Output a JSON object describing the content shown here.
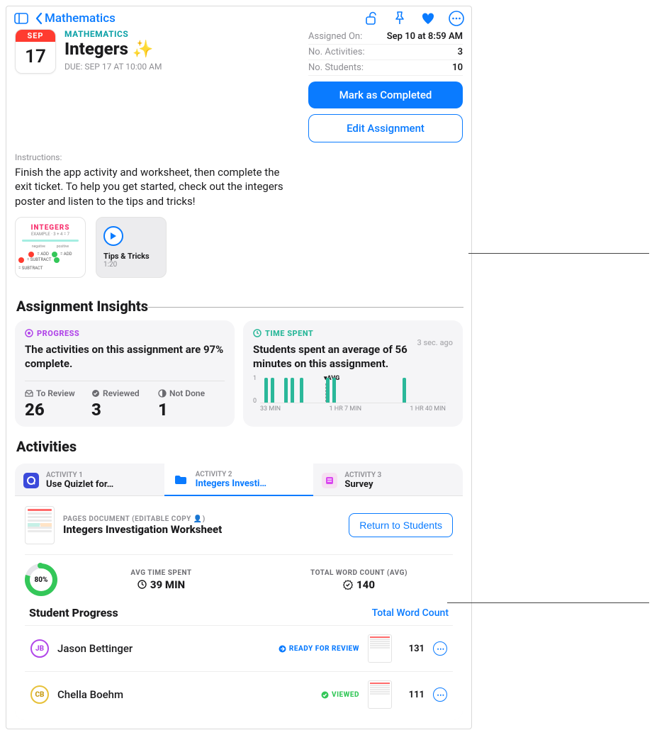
{
  "nav": {
    "back_label": "Mathematics"
  },
  "header": {
    "calendar_month": "SEP",
    "calendar_day": "17",
    "subject": "MATHEMATICS",
    "title": "Integers",
    "title_emoji": "✨",
    "due": "DUE: SEP 17 AT 10:00 AM",
    "assigned_on_label": "Assigned On:",
    "assigned_on_value": "Sep 10 at 8:59 AM",
    "activities_label": "No. Activities:",
    "activities_value": "3",
    "students_label": "No. Students:",
    "students_value": "10",
    "mark_complete": "Mark as Completed",
    "edit_assignment": "Edit Assignment"
  },
  "instructions": {
    "label": "Instructions:",
    "text": "Finish the app activity and worksheet, then complete the exit ticket. To help you get started, check out the integers poster and listen to the tips and tricks!"
  },
  "attachments": {
    "poster_title": "INTEGERS",
    "tips_title": "Tips & Tricks",
    "tips_duration": "1:20"
  },
  "insights": {
    "heading": "Assignment Insights",
    "progress": {
      "label": "PROGRESS",
      "summary": "The activities on this assignment are 97% complete.",
      "to_review_label": "To Review",
      "to_review_value": "26",
      "reviewed_label": "Reviewed",
      "reviewed_value": "3",
      "not_done_label": "Not Done",
      "not_done_value": "1"
    },
    "time": {
      "label": "TIME SPENT",
      "updated": "3 sec. ago",
      "summary": "Students spent an average of 56 minutes on this assignment.",
      "avg_label": "AVG",
      "y0": "0",
      "y1": "1",
      "x0": "33 MIN",
      "x1": "1 HR 7 MIN",
      "x2": "1 HR 40 MIN"
    }
  },
  "activities": {
    "heading": "Activities",
    "tabs": [
      {
        "num": "ACTIVITY 1",
        "name": "Use Quizlet for…"
      },
      {
        "num": "ACTIVITY 2",
        "name": "Integers Investi…"
      },
      {
        "num": "ACTIVITY 3",
        "name": "Survey"
      }
    ],
    "doc_type": "PAGES DOCUMENT (EDITABLE COPY 👤)",
    "doc_title": "Integers Investigation Worksheet",
    "return_btn": "Return to Students",
    "donut_pct": "80%",
    "avg_time_label": "AVG TIME SPENT",
    "avg_time_value": "39 MIN",
    "word_count_label": "TOTAL WORD COUNT (AVG)",
    "word_count_value": "140"
  },
  "student_progress": {
    "heading": "Student Progress",
    "link": "Total Word Count",
    "students": [
      {
        "initials": "JB",
        "name": "Jason Bettinger",
        "status": "READY FOR REVIEW",
        "status_color": "#0a7bff",
        "ring": "#b146e9",
        "count": "131"
      },
      {
        "initials": "CB",
        "name": "Chella Boehm",
        "status": "VIEWED",
        "status_color": "#34c759",
        "ring": "#e7c13a",
        "count": "111"
      }
    ]
  },
  "chart_data": {
    "type": "bar",
    "description": "Histogram of time spent per student on the assignment",
    "x_range_labels": [
      "33 MIN",
      "1 HR 7 MIN",
      "1 HR 40 MIN"
    ],
    "x_range_minutes": [
      33,
      67,
      100
    ],
    "y_range": [
      0,
      1
    ],
    "avg_minutes": 56,
    "avg_label": "AVG",
    "bars_minutes": [
      36,
      38,
      42,
      44,
      46,
      56,
      58,
      90
    ],
    "bar_height_fraction": [
      1,
      1,
      1,
      1,
      1,
      1,
      1,
      1
    ]
  }
}
